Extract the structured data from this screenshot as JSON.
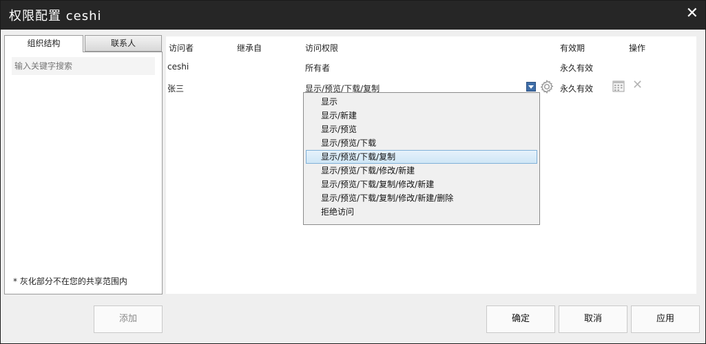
{
  "window": {
    "title": "权限配置 ceshi",
    "close_glyph": "✕"
  },
  "left_panel": {
    "tabs": [
      "组织结构",
      "联系人"
    ],
    "search_placeholder": "输入关键字搜索",
    "note": "* 灰化部分不在您的共享范围内"
  },
  "table": {
    "headers": {
      "visitor": "访问者",
      "inherited_from": "继承自",
      "permission": "访问权限",
      "validity": "有效期",
      "actions": "操作"
    },
    "rows": [
      {
        "visitor": "ceshi",
        "inherited_from": "",
        "permission": "所有者",
        "validity": "永久有效"
      },
      {
        "visitor": "张三",
        "inherited_from": "",
        "permission": "显示/预览/下载/复制",
        "validity": "永久有效"
      }
    ]
  },
  "dropdown": {
    "options": [
      "显示",
      "显示/新建",
      "显示/预览",
      "显示/预览/下载",
      "显示/预览/下载/复制",
      "显示/预览/下载/修改/新建",
      "显示/预览/下载/复制/修改/新建",
      "显示/预览/下载/复制/修改/新建/删除",
      "拒绝访问"
    ],
    "selected": "显示/预览/下载/复制"
  },
  "buttons": {
    "add": "添加",
    "ok": "确定",
    "cancel": "取消",
    "apply": "应用"
  },
  "icons": {
    "gear": "gear-icon",
    "calendar": "calendar-icon",
    "delete": "delete-icon",
    "dropdown": "chevron-down-icon"
  }
}
